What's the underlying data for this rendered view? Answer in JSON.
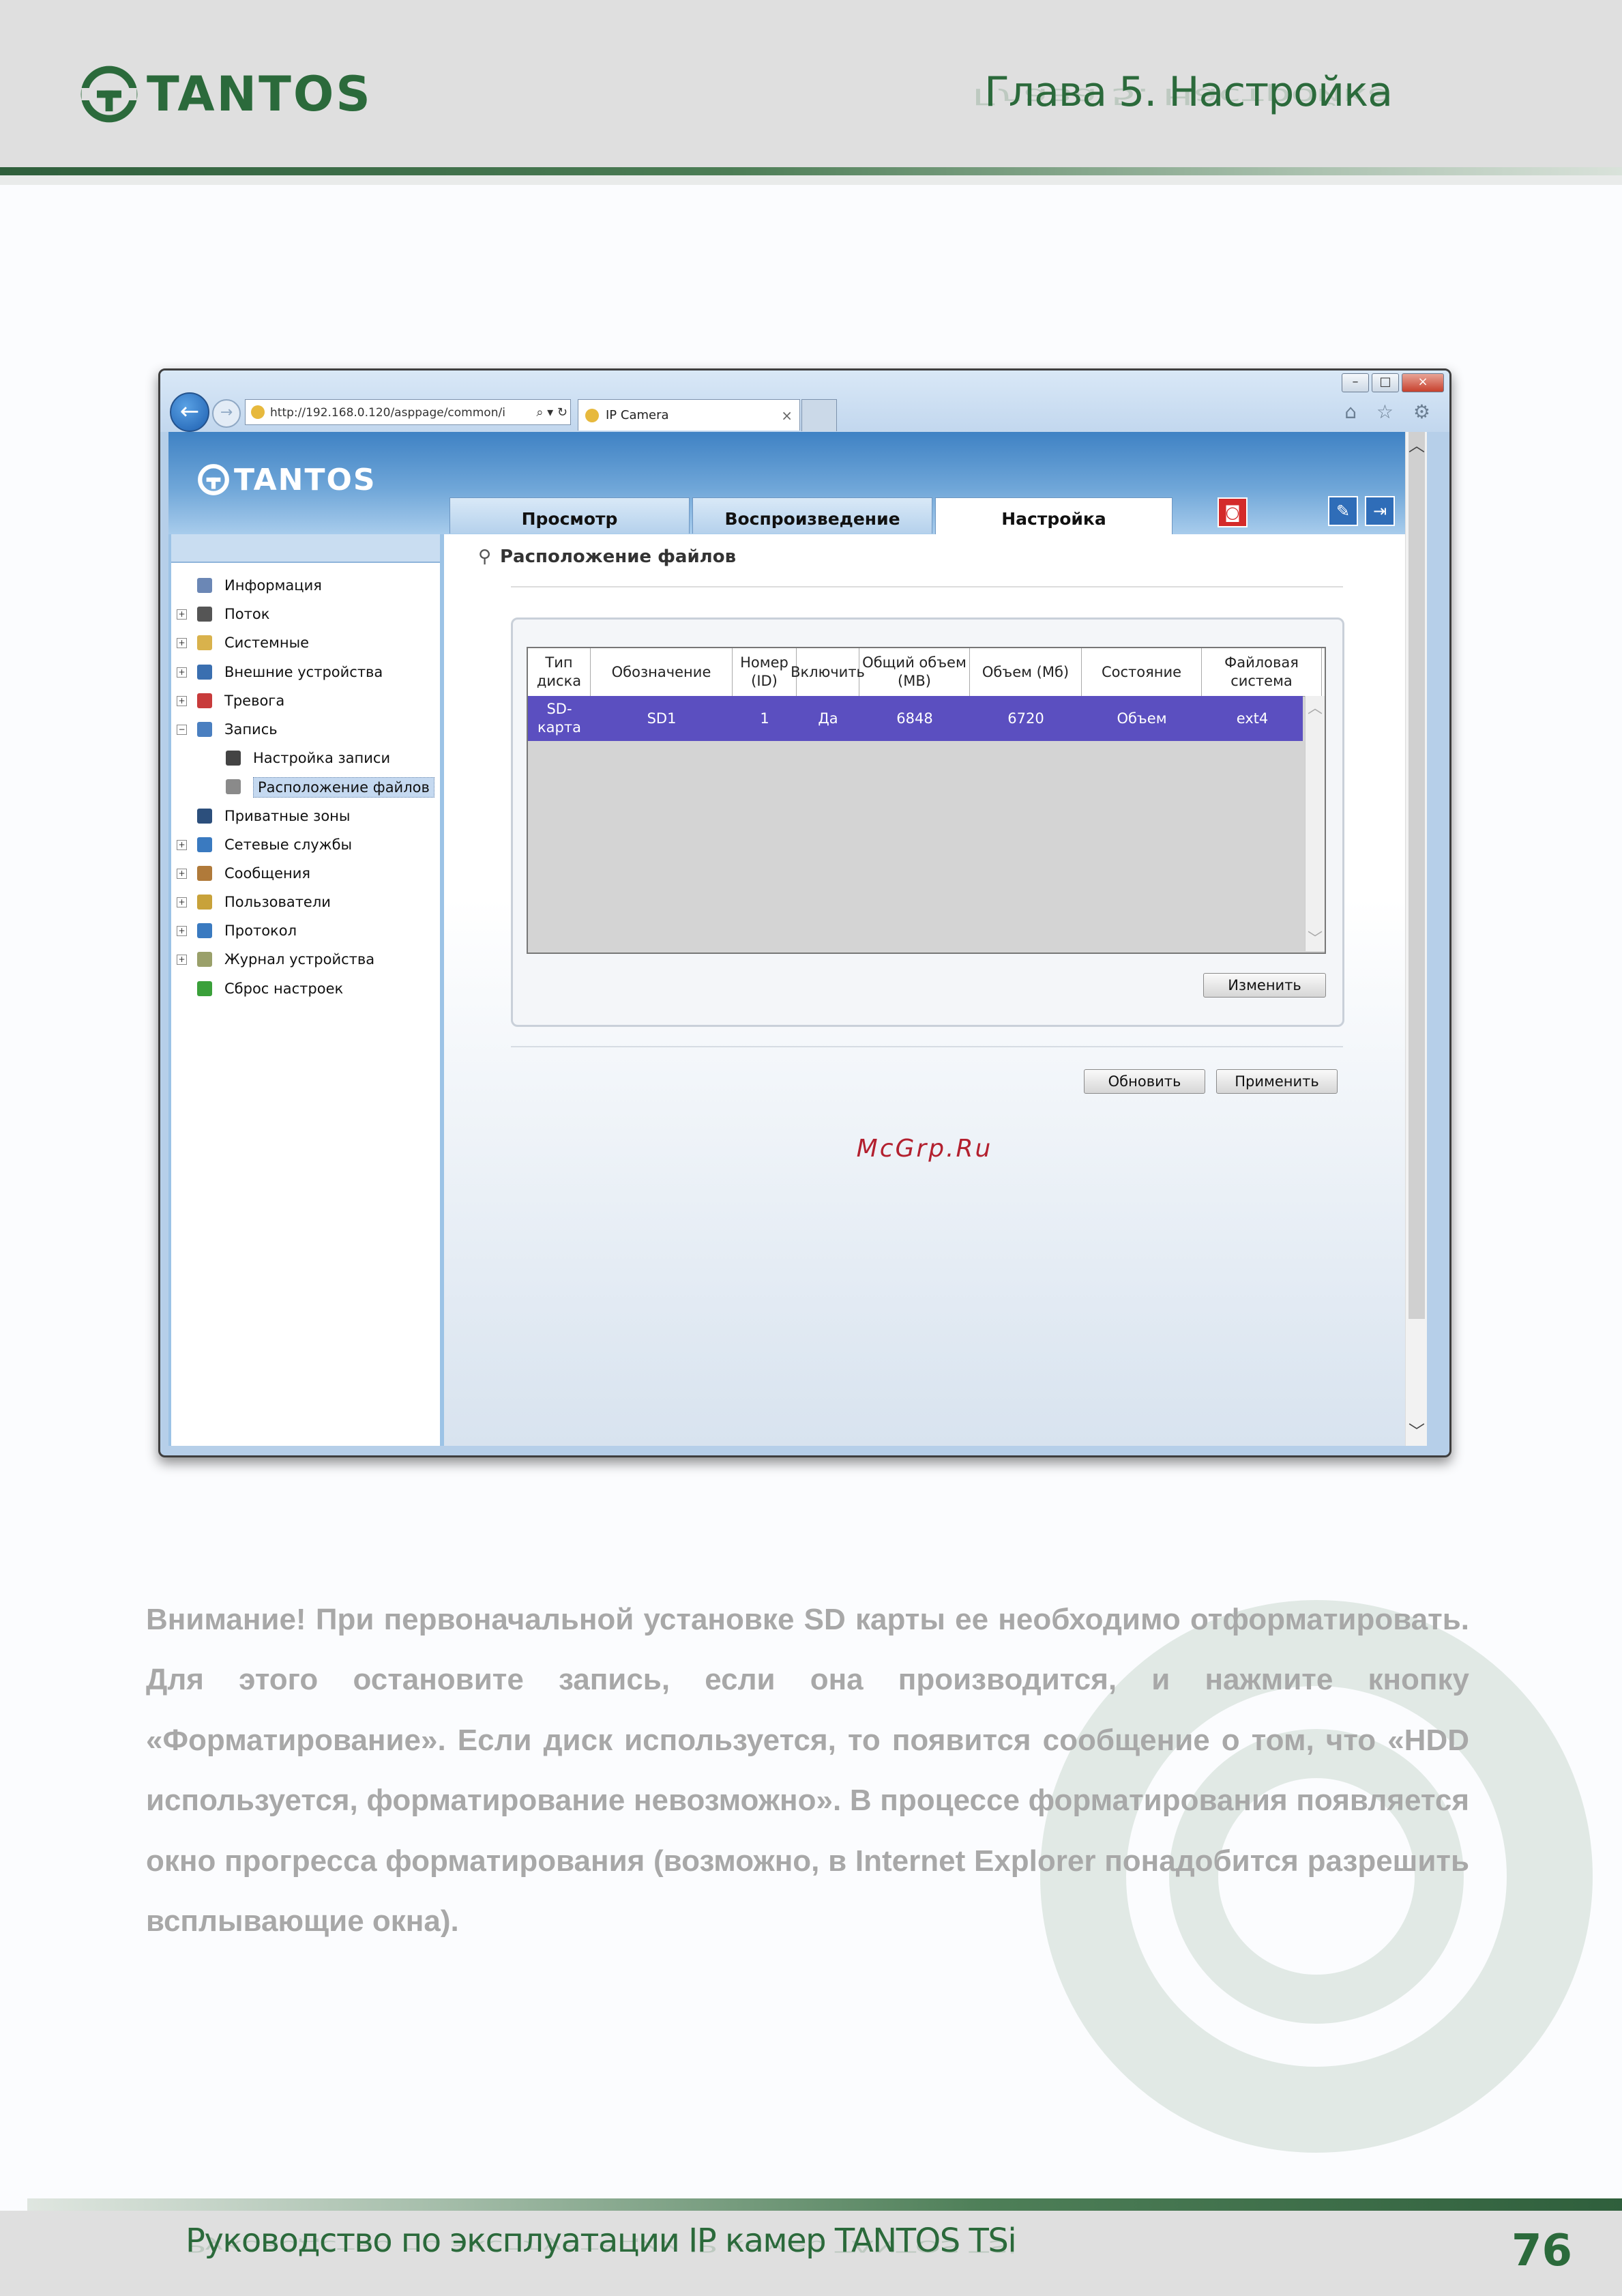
{
  "header": {
    "logo_text": "TANTOS",
    "chapter_title": "Глава 5. Настройка"
  },
  "browser": {
    "address": "http://192.168.0.120/asppage/common/i",
    "address_tools": "⌕ ▾ ↻",
    "tab_title": "IP Camera",
    "tab_close": "×",
    "win_minimize": "–",
    "win_maximize": "□",
    "win_close": "×",
    "chrome_icons": "⌂ ☆ ⚙"
  },
  "app": {
    "logo_text": "TANTOS",
    "nav_tabs": [
      {
        "label": "Просмотр",
        "active": false
      },
      {
        "label": "Воспроизведение",
        "active": false
      },
      {
        "label": "Настройка",
        "active": true
      }
    ],
    "tree": [
      {
        "label": "Информация",
        "expander": "",
        "icon": "info-icon",
        "color": "#6b87b5",
        "level": 0
      },
      {
        "label": "Поток",
        "expander": "+",
        "icon": "stream-icon",
        "color": "#555555",
        "level": 0
      },
      {
        "label": "Системные",
        "expander": "+",
        "icon": "system-icon",
        "color": "#d9b24c",
        "level": 0
      },
      {
        "label": "Внешние устройства",
        "expander": "+",
        "icon": "devices-icon",
        "color": "#3a6fb0",
        "level": 0
      },
      {
        "label": "Тревога",
        "expander": "+",
        "icon": "alarm-icon",
        "color": "#c83b3b",
        "level": 0
      },
      {
        "label": "Запись",
        "expander": "−",
        "icon": "record-icon",
        "color": "#4a7fc0",
        "level": 0
      },
      {
        "label": "Настройка записи",
        "expander": "",
        "icon": "record-settings-icon",
        "color": "#444444",
        "level": 1
      },
      {
        "label": "Расположение файлов",
        "expander": "",
        "icon": "file-location-icon",
        "color": "#8a8a8a",
        "level": 1,
        "selected": true
      },
      {
        "label": "Приватные зоны",
        "expander": "",
        "icon": "privacy-zone-icon",
        "color": "#2c4f7c",
        "level": 0
      },
      {
        "label": "Сетевые службы",
        "expander": "+",
        "icon": "network-icon",
        "color": "#3a7ac0",
        "level": 0
      },
      {
        "label": "Сообщения",
        "expander": "+",
        "icon": "messages-icon",
        "color": "#b07a3a",
        "level": 0
      },
      {
        "label": "Пользователи",
        "expander": "+",
        "icon": "users-icon",
        "color": "#c8a23a",
        "level": 0
      },
      {
        "label": "Протокол",
        "expander": "+",
        "icon": "protocol-icon",
        "color": "#3a7ac0",
        "level": 0
      },
      {
        "label": "Журнал устройства",
        "expander": "+",
        "icon": "device-log-icon",
        "color": "#9aa06a",
        "level": 0
      },
      {
        "label": "Сброс настроек",
        "expander": "",
        "icon": "reset-icon",
        "color": "#3aa03a",
        "level": 0
      }
    ],
    "section_title": "Расположение файлов",
    "table": {
      "headers": [
        "Тип диска",
        "Обозначение",
        "Номер (ID)",
        "Включить",
        "Общий объем (MB)",
        "Объем (Мб)",
        "Состояние",
        "Файловая система"
      ],
      "rows": [
        [
          "SD-карта",
          "SD1",
          "1",
          "Да",
          "6848",
          "6720",
          "Объем",
          "ext4"
        ]
      ]
    },
    "buttons": {
      "change": "Изменить",
      "refresh": "Обновить",
      "apply": "Применить"
    },
    "watermark": "McGrp.Ru"
  },
  "note_text": "Внимание! При первоначальной установке SD карты ее необходимо отформатировать. Для этого остановите запись, если она производится, и нажмите кнопку «Форматирование». Если диск используется, то появится сообщение о том, что «HDD используется, форматирование невозможно». В процессе форматирования появляется окно прогресса форматирования (возможно, в Internet Explorer понадобится разрешить всплывающие окна).",
  "footer": {
    "title": "Руководство по эксплуатации IP камер TANTOS TSi",
    "page_number": "76"
  }
}
